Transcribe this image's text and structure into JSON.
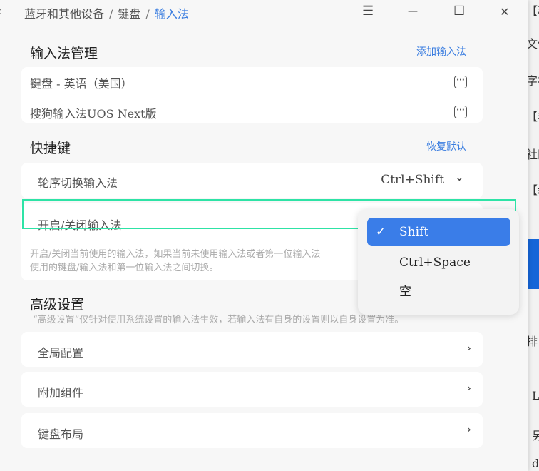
{
  "background_window": {
    "fragments": [
      "【移",
      "文件",
      "字符",
      "【非",
      "社区",
      "【新",
      "排",
      "L",
      "另",
      "d"
    ]
  },
  "header": {
    "breadcrumb": [
      "蓝牙和其他设备",
      "键盘",
      "输入法"
    ],
    "separator": "/"
  },
  "icons": {
    "back": "‹",
    "menu": "☰",
    "minimize": "—",
    "maximize": "☐",
    "close": "✕",
    "more": "···",
    "chevron_right": "›",
    "chevron_down": "⌄",
    "check": "✓"
  },
  "ime_management": {
    "title": "输入法管理",
    "add_link": "添加输入法",
    "items": [
      "键盘 - 英语（美国）",
      "搜狗输入法UOS Next版"
    ]
  },
  "shortcuts": {
    "title": "快捷键",
    "reset_link": "恢复默认",
    "items": [
      {
        "label": "轮序切换输入法",
        "value": "Ctrl+Shift"
      },
      {
        "label": "开启/关闭输入法"
      }
    ],
    "note": [
      "开启/关闭当前使用的输入法，如果当前未使用输入法或者第一位输入法",
      "使用的键盘/输入法和第一位输入法之间切换。"
    ]
  },
  "dropdown": {
    "options": [
      "Shift",
      "Ctrl+Space",
      "空"
    ],
    "selected": "Shift"
  },
  "advanced": {
    "title": "高级设置",
    "note": "“高级设置”仅针对使用系统设置的输入法生效，若输入法有自身的设置则以自身设置为准。",
    "items": [
      "全局配置",
      "附加组件",
      "键盘布局"
    ]
  },
  "colors": {
    "accent": "#3a7de0",
    "highlight": "#2ee3a6"
  }
}
